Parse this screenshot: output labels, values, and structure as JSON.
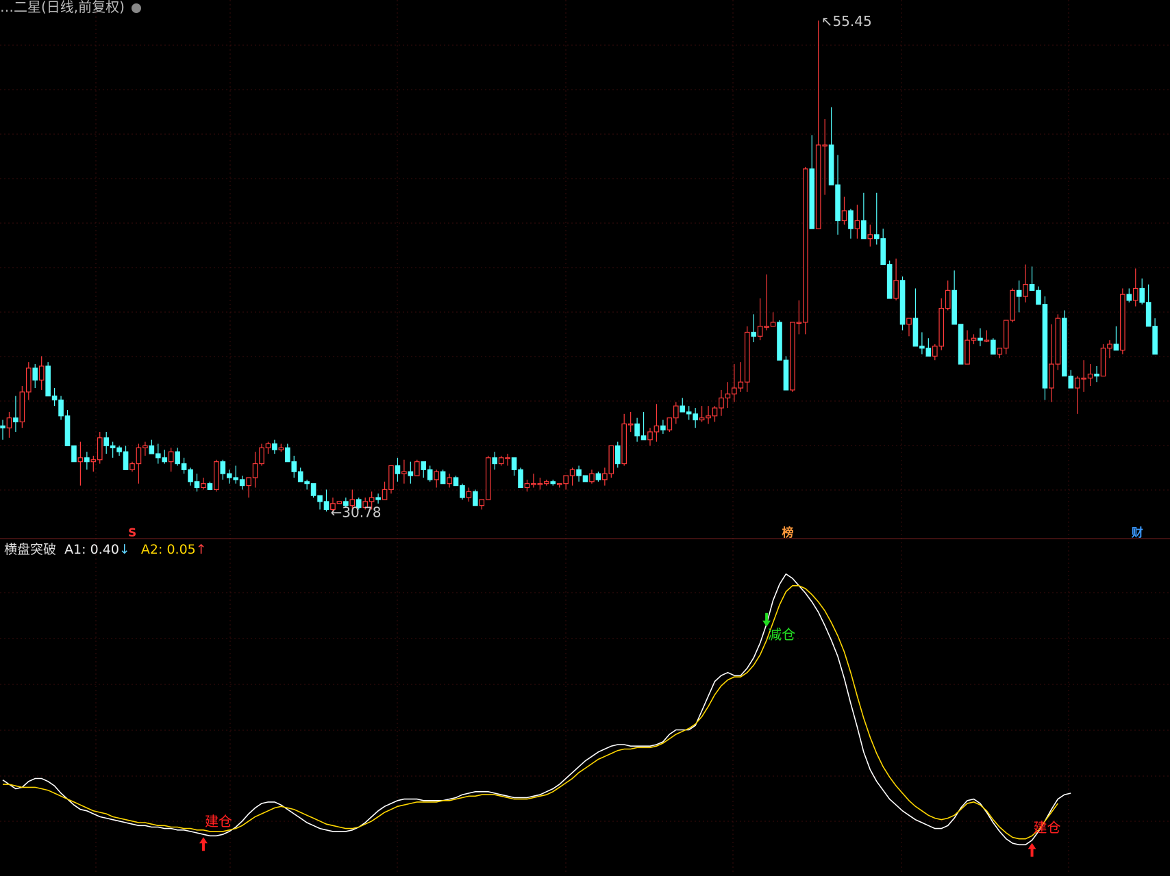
{
  "header": {
    "title": "…二星(日线,前复权)",
    "title_icon": "settings-dot-icon"
  },
  "indicator": {
    "name": "横盘突破",
    "a1_label": "A1:",
    "a1_value": "0.40",
    "a1_dir": "↓",
    "a2_label": "A2:",
    "a2_value": "0.05",
    "a2_dir": "↑",
    "colors": {
      "a1": "#ffffff",
      "a2": "#ffd700"
    }
  },
  "price_chart": {
    "high_label": "55.45",
    "low_label": "30.78",
    "event_markers": [
      {
        "text": "S",
        "bar": 20,
        "color": "#ff3333"
      },
      {
        "text": "榜",
        "bar": 121,
        "color": "#ff9a3c"
      },
      {
        "text": "财",
        "bar": 175,
        "color": "#3c9aff"
      }
    ],
    "colors": {
      "up": "#ff3b3b",
      "down": "#54ffff",
      "grid": "#3a0d0d"
    }
  },
  "signals": [
    {
      "text": "建仓",
      "bar": 31,
      "type": "buy",
      "color": "#ff2020"
    },
    {
      "text": "减仓",
      "bar": 118,
      "type": "sell",
      "color": "#22dd22"
    },
    {
      "text": "建仓",
      "bar": 159,
      "type": "buy",
      "color": "#ff2020"
    }
  ],
  "chart_data": {
    "type": "candlestick",
    "y_range_price": [
      30.78,
      55.45
    ],
    "candles": [
      [
        35.1,
        35.4,
        34.4,
        35.0
      ],
      [
        35.0,
        35.8,
        34.5,
        35.5
      ],
      [
        35.5,
        36.6,
        34.8,
        35.3
      ],
      [
        35.3,
        37.1,
        35.0,
        36.8
      ],
      [
        36.8,
        38.3,
        36.4,
        38.0
      ],
      [
        38.0,
        38.2,
        37.0,
        37.4
      ],
      [
        37.4,
        38.6,
        36.9,
        38.1
      ],
      [
        38.1,
        38.3,
        36.6,
        36.6
      ],
      [
        36.6,
        37.0,
        36.1,
        36.4
      ],
      [
        36.4,
        36.6,
        35.4,
        35.6
      ],
      [
        35.6,
        35.9,
        34.4,
        34.1
      ],
      [
        34.1,
        33.7,
        33.4,
        33.3
      ],
      [
        33.3,
        34.3,
        32.1,
        33.5
      ],
      [
        33.5,
        33.8,
        32.9,
        33.3
      ],
      [
        33.3,
        33.6,
        32.8,
        33.4
      ],
      [
        33.4,
        34.8,
        33.2,
        34.5
      ],
      [
        34.5,
        34.8,
        33.7,
        34.1
      ],
      [
        34.1,
        34.3,
        33.5,
        34.0
      ],
      [
        34.0,
        34.1,
        33.6,
        33.8
      ],
      [
        33.8,
        34.1,
        33.0,
        32.9
      ],
      [
        32.9,
        33.3,
        32.8,
        33.2
      ],
      [
        33.2,
        34.2,
        32.2,
        34.0
      ],
      [
        34.0,
        34.3,
        33.6,
        34.1
      ],
      [
        34.1,
        34.4,
        33.8,
        33.7
      ],
      [
        33.7,
        34.2,
        33.2,
        33.5
      ],
      [
        33.5,
        33.9,
        33.2,
        33.3
      ],
      [
        33.3,
        34.0,
        32.8,
        33.8
      ],
      [
        33.8,
        34.0,
        33.1,
        33.2
      ],
      [
        33.2,
        33.5,
        32.7,
        32.9
      ],
      [
        32.9,
        33.0,
        32.1,
        32.3
      ],
      [
        32.3,
        32.7,
        31.8,
        32.0
      ],
      [
        32.0,
        32.5,
        31.9,
        32.2
      ],
      [
        32.2,
        32.3,
        31.9,
        31.9
      ],
      [
        31.9,
        33.4,
        31.8,
        33.3
      ],
      [
        33.3,
        33.4,
        32.4,
        32.7
      ],
      [
        32.7,
        32.9,
        32.2,
        32.5
      ],
      [
        32.5,
        33.1,
        32.2,
        32.4
      ],
      [
        32.4,
        32.6,
        31.9,
        32.1
      ],
      [
        32.1,
        32.4,
        31.5,
        32.5
      ],
      [
        32.5,
        33.8,
        32.0,
        33.2
      ],
      [
        33.2,
        34.2,
        33.1,
        34.0
      ],
      [
        34.0,
        34.3,
        33.7,
        34.2
      ],
      [
        34.2,
        34.4,
        33.7,
        33.9
      ],
      [
        33.9,
        34.2,
        33.8,
        34.0
      ],
      [
        34.0,
        34.2,
        33.3,
        33.3
      ],
      [
        33.3,
        33.6,
        32.5,
        32.8
      ],
      [
        32.8,
        33.0,
        32.3,
        32.3
      ],
      [
        32.3,
        32.4,
        31.9,
        32.2
      ],
      [
        32.2,
        32.2,
        31.5,
        31.6
      ],
      [
        31.6,
        31.6,
        30.9,
        31.3
      ],
      [
        31.3,
        31.9,
        30.8,
        30.9
      ],
      [
        30.9,
        31.5,
        30.8,
        31.2
      ],
      [
        31.2,
        31.3,
        31.2,
        31.3
      ],
      [
        31.3,
        31.5,
        31.0,
        31.1
      ],
      [
        31.1,
        31.9,
        30.9,
        31.4
      ],
      [
        31.4,
        31.5,
        30.9,
        31.0
      ],
      [
        31.0,
        31.5,
        30.9,
        31.3
      ],
      [
        31.3,
        31.8,
        30.9,
        31.5
      ],
      [
        31.5,
        31.7,
        31.2,
        31.4
      ],
      [
        31.4,
        32.3,
        31.4,
        31.9
      ],
      [
        31.9,
        32.9,
        31.7,
        33.1
      ],
      [
        33.1,
        33.5,
        32.3,
        32.7
      ],
      [
        32.7,
        33.4,
        32.2,
        32.8
      ],
      [
        32.8,
        33.3,
        32.2,
        32.6
      ],
      [
        32.6,
        33.4,
        32.6,
        33.3
      ],
      [
        33.3,
        33.3,
        32.5,
        32.9
      ],
      [
        32.9,
        33.1,
        32.3,
        32.4
      ],
      [
        32.4,
        32.9,
        32.0,
        32.8
      ],
      [
        32.8,
        32.9,
        32.3,
        32.2
      ],
      [
        32.2,
        32.7,
        32.0,
        32.5
      ],
      [
        32.5,
        32.6,
        32.1,
        32.1
      ],
      [
        32.1,
        32.2,
        31.4,
        31.5
      ],
      [
        31.5,
        32.0,
        31.3,
        31.8
      ],
      [
        31.8,
        31.9,
        31.4,
        31.1
      ],
      [
        31.1,
        31.2,
        30.9,
        31.4
      ],
      [
        31.4,
        33.6,
        31.4,
        33.5
      ],
      [
        33.5,
        33.8,
        32.9,
        33.2
      ],
      [
        33.2,
        33.6,
        33.1,
        33.5
      ],
      [
        33.5,
        33.7,
        33.1,
        33.5
      ],
      [
        33.5,
        33.5,
        32.6,
        32.9
      ],
      [
        32.9,
        33.0,
        32.0,
        32.0
      ],
      [
        32.0,
        32.4,
        31.8,
        32.2
      ],
      [
        32.2,
        32.7,
        32.0,
        32.2
      ],
      [
        32.2,
        32.5,
        31.9,
        32.2
      ],
      [
        32.2,
        32.4,
        32.1,
        32.3
      ],
      [
        32.3,
        32.4,
        32.1,
        32.2
      ],
      [
        32.2,
        32.2,
        32.0,
        32.2
      ],
      [
        32.2,
        32.4,
        31.9,
        32.6
      ],
      [
        32.6,
        33.0,
        32.1,
        32.9
      ],
      [
        32.9,
        33.1,
        32.3,
        32.6
      ],
      [
        32.6,
        32.6,
        32.3,
        32.3
      ],
      [
        32.3,
        32.9,
        32.2,
        32.7
      ],
      [
        32.7,
        32.8,
        32.3,
        32.4
      ],
      [
        32.4,
        33.0,
        32.1,
        32.7
      ],
      [
        32.7,
        34.0,
        32.5,
        34.1
      ],
      [
        34.1,
        34.3,
        33.0,
        33.2
      ],
      [
        33.2,
        35.7,
        33.1,
        35.2
      ],
      [
        35.2,
        35.8,
        34.8,
        35.2
      ],
      [
        35.2,
        35.5,
        34.3,
        34.6
      ],
      [
        34.6,
        35.8,
        34.4,
        34.4
      ],
      [
        34.4,
        35.0,
        34.1,
        34.8
      ],
      [
        34.8,
        36.2,
        34.3,
        35.1
      ],
      [
        35.1,
        35.4,
        34.7,
        34.9
      ],
      [
        34.9,
        35.3,
        34.8,
        35.5
      ],
      [
        35.5,
        36.3,
        35.2,
        36.1
      ],
      [
        36.1,
        36.5,
        35.8,
        35.8
      ],
      [
        35.8,
        36.1,
        35.4,
        35.7
      ],
      [
        35.7,
        36.0,
        35.0,
        35.4
      ],
      [
        35.4,
        36.1,
        35.3,
        35.5
      ],
      [
        35.5,
        36.1,
        35.2,
        35.6
      ],
      [
        35.6,
        36.1,
        35.3,
        36.0
      ],
      [
        36.0,
        36.9,
        35.6,
        36.5
      ],
      [
        36.5,
        37.3,
        36.0,
        36.7
      ],
      [
        36.7,
        38.2,
        36.3,
        37.0
      ],
      [
        37.0,
        38.3,
        36.8,
        37.3
      ],
      [
        37.3,
        40.1,
        36.8,
        39.8
      ],
      [
        39.8,
        40.7,
        39.3,
        39.6
      ],
      [
        39.6,
        41.5,
        39.4,
        40.1
      ],
      [
        40.1,
        42.7,
        39.9,
        40.1
      ],
      [
        40.1,
        40.8,
        40.1,
        40.3
      ],
      [
        40.3,
        40.4,
        38.4,
        38.4
      ],
      [
        38.4,
        38.6,
        37.8,
        36.9
      ],
      [
        36.9,
        39.1,
        36.8,
        40.3
      ],
      [
        40.3,
        41.4,
        39.7,
        40.3
      ],
      [
        40.3,
        48.1,
        39.7,
        48.0
      ],
      [
        48.0,
        49.7,
        45.1,
        45.0
      ],
      [
        45.0,
        55.45,
        45.0,
        49.2
      ],
      [
        49.2,
        50.5,
        46.7,
        49.2
      ],
      [
        49.2,
        51.1,
        48.6,
        47.2
      ],
      [
        47.2,
        48.7,
        44.7,
        45.4
      ],
      [
        45.4,
        46.6,
        45.2,
        45.9
      ],
      [
        45.9,
        46.0,
        44.5,
        45.0
      ],
      [
        45.0,
        46.2,
        44.5,
        45.4
      ],
      [
        45.4,
        46.8,
        44.7,
        44.5
      ],
      [
        44.5,
        45.2,
        44.1,
        44.7
      ],
      [
        44.7,
        46.8,
        44.2,
        44.5
      ],
      [
        44.5,
        45.0,
        43.7,
        43.2
      ],
      [
        43.2,
        43.4,
        41.5,
        41.5
      ],
      [
        41.5,
        43.5,
        41.4,
        42.4
      ],
      [
        42.4,
        42.6,
        39.9,
        40.2
      ],
      [
        40.2,
        40.4,
        39.6,
        40.5
      ],
      [
        40.5,
        42.0,
        39.6,
        39.1
      ],
      [
        39.1,
        39.8,
        38.7,
        39.0
      ],
      [
        39.0,
        39.5,
        38.7,
        38.6
      ],
      [
        38.6,
        39.2,
        38.4,
        39.1
      ],
      [
        39.1,
        41.5,
        38.9,
        41.0
      ],
      [
        41.0,
        42.4,
        40.9,
        41.9
      ],
      [
        41.9,
        42.9,
        41.9,
        40.2
      ],
      [
        40.2,
        40.2,
        38.7,
        38.2
      ],
      [
        38.2,
        39.9,
        38.5,
        39.4
      ],
      [
        39.4,
        39.7,
        39.2,
        39.5
      ],
      [
        39.5,
        40.0,
        39.1,
        39.4
      ],
      [
        39.4,
        39.9,
        39.3,
        39.4
      ],
      [
        39.4,
        39.5,
        38.8,
        38.7
      ],
      [
        38.7,
        38.9,
        38.5,
        39.0
      ],
      [
        39.0,
        40.1,
        38.7,
        40.4
      ],
      [
        40.4,
        42.0,
        40.3,
        41.9
      ],
      [
        41.9,
        42.4,
        40.8,
        41.6
      ],
      [
        41.6,
        43.2,
        41.3,
        42.2
      ],
      [
        42.2,
        43.1,
        41.9,
        41.9
      ],
      [
        41.9,
        42.1,
        41.2,
        41.2
      ],
      [
        41.2,
        41.6,
        36.4,
        37.0
      ],
      [
        37.0,
        40.2,
        36.3,
        38.2
      ],
      [
        38.2,
        40.7,
        37.9,
        40.5
      ],
      [
        40.5,
        40.9,
        37.9,
        37.6
      ],
      [
        37.6,
        37.9,
        37.3,
        37.0
      ],
      [
        37.0,
        37.6,
        35.7,
        37.5
      ],
      [
        37.5,
        38.4,
        36.8,
        37.5
      ],
      [
        37.5,
        38.2,
        37.1,
        37.7
      ],
      [
        37.7,
        38.1,
        37.3,
        37.6
      ],
      [
        37.6,
        39.2,
        37.6,
        39.0
      ],
      [
        39.0,
        39.4,
        38.5,
        39.2
      ],
      [
        39.2,
        40.1,
        38.9,
        38.9
      ],
      [
        38.9,
        42.0,
        38.7,
        41.7
      ],
      [
        41.7,
        42.0,
        41.3,
        41.4
      ],
      [
        41.4,
        43.0,
        41.1,
        42.0
      ],
      [
        42.0,
        42.5,
        41.2,
        41.3
      ],
      [
        41.3,
        42.2,
        40.8,
        40.1
      ],
      [
        40.1,
        40.5,
        38.7,
        38.7
      ]
    ],
    "a1_series": [
      0.49,
      0.46,
      0.43,
      0.44,
      0.48,
      0.5,
      0.5,
      0.48,
      0.45,
      0.4,
      0.36,
      0.32,
      0.29,
      0.28,
      0.26,
      0.24,
      0.23,
      0.22,
      0.21,
      0.2,
      0.19,
      0.18,
      0.18,
      0.17,
      0.17,
      0.16,
      0.16,
      0.15,
      0.15,
      0.14,
      0.13,
      0.12,
      0.11,
      0.11,
      0.12,
      0.14,
      0.17,
      0.21,
      0.26,
      0.3,
      0.33,
      0.34,
      0.34,
      0.32,
      0.29,
      0.26,
      0.23,
      0.2,
      0.18,
      0.16,
      0.15,
      0.14,
      0.14,
      0.14,
      0.15,
      0.17,
      0.2,
      0.24,
      0.28,
      0.31,
      0.33,
      0.35,
      0.36,
      0.36,
      0.36,
      0.35,
      0.35,
      0.35,
      0.35,
      0.36,
      0.37,
      0.39,
      0.4,
      0.41,
      0.41,
      0.41,
      0.4,
      0.39,
      0.38,
      0.37,
      0.37,
      0.37,
      0.38,
      0.39,
      0.41,
      0.43,
      0.46,
      0.5,
      0.54,
      0.58,
      0.62,
      0.65,
      0.68,
      0.7,
      0.72,
      0.73,
      0.73,
      0.72,
      0.72,
      0.72,
      0.72,
      0.73,
      0.75,
      0.8,
      0.83,
      0.83,
      0.83,
      0.86,
      0.96,
      1.06,
      1.16,
      1.2,
      1.22,
      1.2,
      1.2,
      1.25,
      1.32,
      1.42,
      1.55,
      1.71,
      1.82,
      1.89,
      1.86,
      1.81,
      1.76,
      1.7,
      1.63,
      1.54,
      1.44,
      1.33,
      1.18,
      1.01,
      0.85,
      0.68,
      0.56,
      0.48,
      0.42,
      0.36,
      0.32,
      0.28,
      0.25,
      0.22,
      0.2,
      0.18,
      0.16,
      0.16,
      0.18,
      0.23,
      0.3,
      0.35,
      0.36,
      0.33,
      0.27,
      0.2,
      0.14,
      0.09,
      0.06,
      0.05,
      0.05,
      0.08,
      0.14,
      0.21,
      0.29,
      0.36,
      0.39,
      0.4
    ],
    "a2_series": [
      0.46,
      0.46,
      0.45,
      0.44,
      0.44,
      0.44,
      0.43,
      0.42,
      0.4,
      0.38,
      0.36,
      0.34,
      0.32,
      0.3,
      0.28,
      0.27,
      0.26,
      0.24,
      0.23,
      0.22,
      0.21,
      0.2,
      0.2,
      0.19,
      0.18,
      0.18,
      0.17,
      0.17,
      0.16,
      0.16,
      0.15,
      0.15,
      0.14,
      0.14,
      0.14,
      0.15,
      0.16,
      0.18,
      0.21,
      0.24,
      0.26,
      0.28,
      0.3,
      0.31,
      0.3,
      0.29,
      0.27,
      0.25,
      0.23,
      0.21,
      0.19,
      0.18,
      0.17,
      0.16,
      0.16,
      0.17,
      0.19,
      0.21,
      0.24,
      0.27,
      0.29,
      0.31,
      0.32,
      0.33,
      0.34,
      0.34,
      0.34,
      0.34,
      0.35,
      0.35,
      0.36,
      0.37,
      0.38,
      0.38,
      0.39,
      0.39,
      0.39,
      0.38,
      0.37,
      0.36,
      0.36,
      0.36,
      0.37,
      0.38,
      0.39,
      0.41,
      0.44,
      0.47,
      0.5,
      0.54,
      0.57,
      0.6,
      0.63,
      0.65,
      0.67,
      0.69,
      0.7,
      0.7,
      0.71,
      0.71,
      0.71,
      0.72,
      0.74,
      0.77,
      0.8,
      0.82,
      0.84,
      0.87,
      0.92,
      0.99,
      1.07,
      1.13,
      1.17,
      1.19,
      1.19,
      1.22,
      1.27,
      1.34,
      1.44,
      1.56,
      1.68,
      1.77,
      1.81,
      1.81,
      1.79,
      1.75,
      1.7,
      1.64,
      1.56,
      1.47,
      1.36,
      1.22,
      1.06,
      0.91,
      0.78,
      0.67,
      0.58,
      0.51,
      0.45,
      0.4,
      0.35,
      0.31,
      0.28,
      0.25,
      0.23,
      0.22,
      0.23,
      0.25,
      0.29,
      0.33,
      0.34,
      0.32,
      0.28,
      0.22,
      0.17,
      0.13,
      0.1,
      0.09,
      0.09,
      0.11,
      0.15,
      0.21,
      0.27,
      0.33
    ]
  }
}
